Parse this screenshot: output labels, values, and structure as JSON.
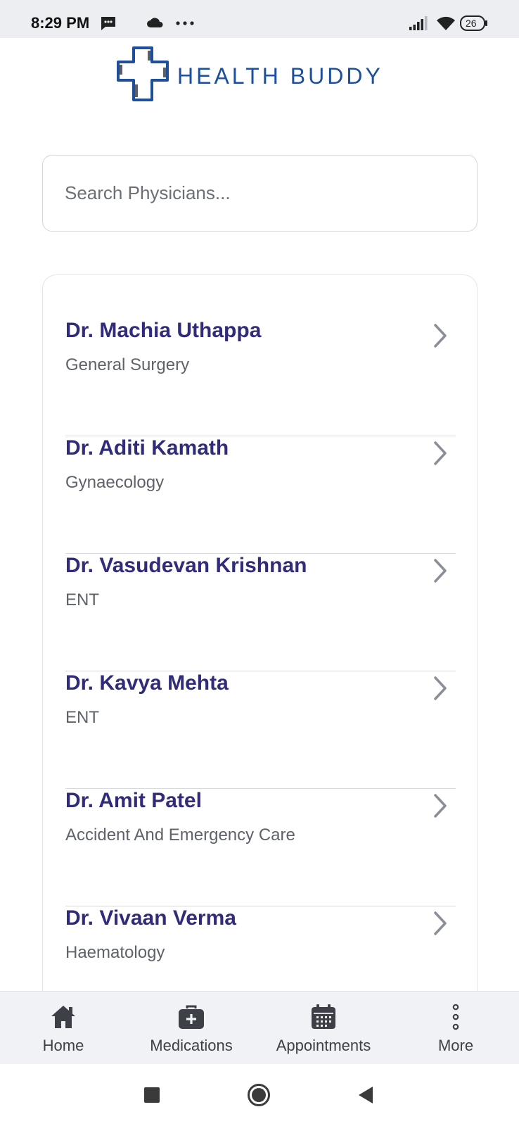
{
  "status_bar": {
    "time": "8:29 PM",
    "battery": "26",
    "icons": [
      "message-icon",
      "cloud-icon",
      "more-dots-icon",
      "signal-icon",
      "wifi-icon",
      "battery-icon"
    ]
  },
  "logo": {
    "text": "HEALTH BUDDY",
    "color": "#1e4f9c"
  },
  "search": {
    "placeholder": "Search Physicians..."
  },
  "physicians": [
    {
      "name": "Dr. Machia Uthappa",
      "specialty": "General Surgery"
    },
    {
      "name": "Dr. Aditi Kamath",
      "specialty": "Gynaecology"
    },
    {
      "name": "Dr. Vasudevan Krishnan",
      "specialty": "ENT"
    },
    {
      "name": "Dr. Kavya Mehta",
      "specialty": "ENT"
    },
    {
      "name": "Dr. Amit Patel",
      "specialty": "Accident And Emergency Care"
    },
    {
      "name": "Dr. Vivaan Verma",
      "specialty": "Haematology"
    }
  ],
  "bottom_nav": {
    "items": [
      {
        "label": "Home",
        "icon": "home-icon"
      },
      {
        "label": "Medications",
        "icon": "medical-kit-icon"
      },
      {
        "label": "Appointments",
        "icon": "calendar-icon"
      },
      {
        "label": "More",
        "icon": "vertical-dots-icon"
      }
    ]
  },
  "colors": {
    "name": "#302c7a",
    "specialty": "#5e6269",
    "accent": "#1e4f9c",
    "chevron": "#8a8e96"
  }
}
